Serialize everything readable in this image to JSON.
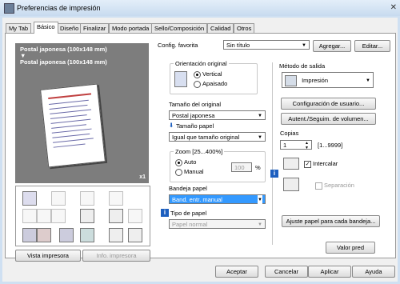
{
  "window": {
    "title": "Preferencias de impresión"
  },
  "tabs": [
    {
      "label": "My Tab"
    },
    {
      "label": "Básico"
    },
    {
      "label": "Diseño"
    },
    {
      "label": "Finalizar"
    },
    {
      "label": "Modo portada"
    },
    {
      "label": "Sello/Composición"
    },
    {
      "label": "Calidad"
    },
    {
      "label": "Otros"
    }
  ],
  "preview": {
    "line1": "Postal japonesa (100x148 mm)",
    "arrow": "▼",
    "line2": "Postal japonesa (100x148 mm)",
    "copies_badge": "x1"
  },
  "left_buttons": {
    "printer_view": "Vista impresora",
    "printer_info": "Info. impresora"
  },
  "config": {
    "label": "Config. favorita",
    "value": "Sin título",
    "add": "Agregar...",
    "edit": "Editar..."
  },
  "orientation": {
    "title": "Orientación original",
    "portrait": "Vertical",
    "landscape": "Apaisado",
    "selected": "Vertical"
  },
  "original_size": {
    "label": "Tamaño del original",
    "value": "Postal japonesa"
  },
  "paper_size": {
    "label": "Tamaño papel",
    "value": "Igual que tamaño original"
  },
  "zoom": {
    "title": "Zoom [25...400%]",
    "auto": "Auto",
    "manual": "Manual",
    "value": "100",
    "unit": "%"
  },
  "tray": {
    "label": "Bandeja papel",
    "value": "Band. entr. manual"
  },
  "paper_type": {
    "label": "Tipo de papel",
    "value": "Papel normal"
  },
  "output": {
    "label": "Método de salida",
    "value": "Impresión"
  },
  "user_settings": "Configuración de usuario...",
  "auth": "Autent./Seguim. de volumen...",
  "copies": {
    "label": "Copias",
    "value": "1",
    "range": "[1...9999]"
  },
  "collate": {
    "label": "Intercalar",
    "checked": true
  },
  "separation": {
    "label": "Separación",
    "checked": false
  },
  "adjust_paper": "Ajuste papel para cada bandeja...",
  "default_value": "Valor pred",
  "footer": {
    "ok": "Aceptar",
    "cancel": "Cancelar",
    "apply": "Aplicar",
    "help": "Ayuda"
  }
}
